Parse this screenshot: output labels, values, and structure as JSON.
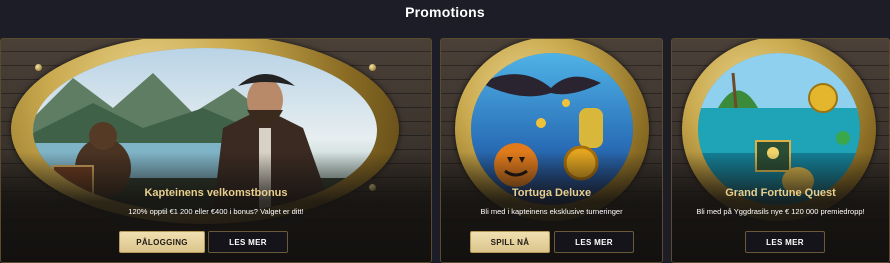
{
  "page": {
    "heading": "Promotions"
  },
  "promotions": [
    {
      "title": "Kapteinens velkomstbonus",
      "subtitle": "120% opptil €1 200 eller €400 i bonus? Valget er ditt!",
      "primary_button": "PÅLOGGING",
      "secondary_button": "LES MER"
    },
    {
      "title": "Tortuga Deluxe",
      "subtitle": "Bli med i kapteinens eksklusive turneringer",
      "primary_button": "SPILL NÅ",
      "secondary_button": "LES MER"
    },
    {
      "title": "Grand Fortune Quest",
      "subtitle": "Bli med på Yggdrasils nye € 120 000 premiedropp!",
      "secondary_button": "LES MER"
    }
  ],
  "colors": {
    "background": "#1c1d26",
    "title_gold": "#e9cf8d",
    "primary_button": "#e6d29e",
    "secondary_button": "#15141a"
  }
}
